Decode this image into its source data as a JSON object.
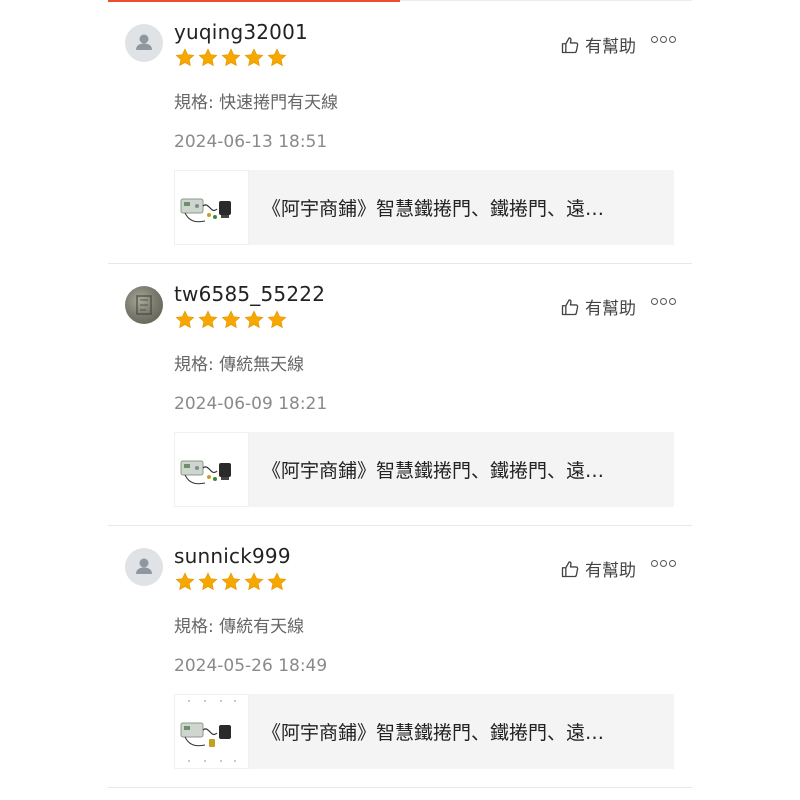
{
  "colors": {
    "accent": "#ee4d2d",
    "star": "#f6a700",
    "divider": "#e8e8e8"
  },
  "helpful_label": "有幫助",
  "reviews": [
    {
      "username": "yuqing32001",
      "rating": 5,
      "variation": "規格: 快速捲門有天線",
      "timestamp": "2024-06-13 18:51",
      "product_title": "《阿宇商鋪》智慧鐵捲門、鐵捲門、遠…",
      "avatar": "default-avatar-icon"
    },
    {
      "username": "tw6585_55222",
      "rating": 5,
      "variation": "規格: 傳統無天線",
      "timestamp": "2024-06-09 18:21",
      "product_title": "《阿宇商鋪》智慧鐵捲門、鐵捲門、遠…",
      "avatar": "photo-avatar"
    },
    {
      "username": "sunnick999",
      "rating": 5,
      "variation": "規格: 傳統有天線",
      "timestamp": "2024-05-26 18:49",
      "product_title": "《阿宇商鋪》智慧鐵捲門、鐵捲門、遠…",
      "avatar": "default-avatar-icon"
    }
  ]
}
